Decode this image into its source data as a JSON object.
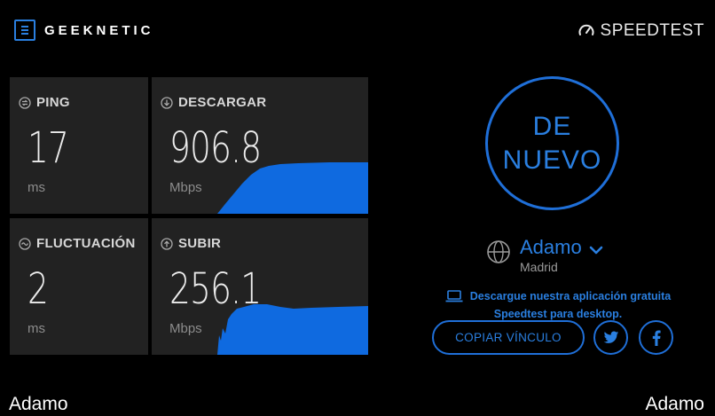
{
  "brand": {
    "name": "GEEKNETIC",
    "logo_icon": "geeknetic-logo-icon"
  },
  "header": {
    "speedtest_label": "SPEEDTEST"
  },
  "metrics": [
    {
      "label": "PING",
      "value": "17",
      "unit": "ms",
      "icon": "ping-icon"
    },
    {
      "label": "DESCARGAR",
      "value": "906.8",
      "unit": "Mbps",
      "icon": "download-icon",
      "graph_fill": 1.0
    },
    {
      "label": "FLUCTUACIÓN",
      "value": "2",
      "unit": "ms",
      "icon": "jitter-icon"
    },
    {
      "label": "SUBIR",
      "value": "256.1",
      "unit": "Mbps",
      "icon": "upload-icon",
      "graph_fill": 1.0
    }
  ],
  "go_button": {
    "line1": "DE",
    "line2": "NUEVO"
  },
  "server": {
    "name": "Adamo",
    "location": "Madrid"
  },
  "promo": {
    "line1": "Descargue nuestra aplicación gratuita",
    "line2": "Speedtest para desktop."
  },
  "share": {
    "copy_label": "COPIAR VÍNCULO",
    "twitter_icon": "twitter-icon",
    "facebook_icon": "facebook-icon"
  },
  "footer": {
    "left": "Adamo",
    "right": "Adamo"
  },
  "colors": {
    "accent": "#1f6fd8",
    "accent_text": "#2a7fe0",
    "tile_bg": "#222222",
    "graph_fill": "#0f6ae0",
    "background": "#000000"
  }
}
